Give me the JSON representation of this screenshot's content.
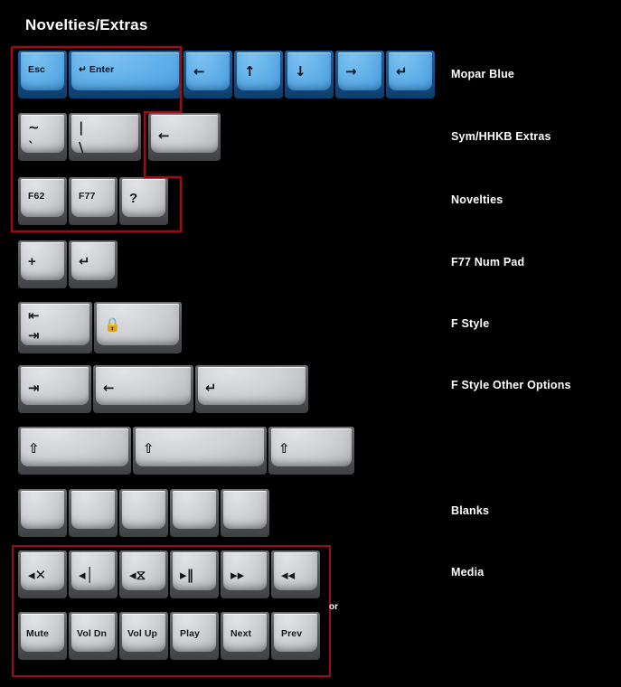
{
  "page": {
    "title": "Novelties/Extras",
    "background_color": "#000000",
    "text_color": "#ffffff",
    "highlight_color": "#9e0b16",
    "blue_cap_color": "#5aabe6",
    "grey_cap_color": "#c6c8cc",
    "or_label": "or"
  },
  "categories": [
    {
      "id": "mopar-blue",
      "label": "Mopar Blue"
    },
    {
      "id": "sym-hhkb-extras",
      "label": "Sym/HHKB Extras"
    },
    {
      "id": "novelties",
      "label": "Novelties"
    },
    {
      "id": "f77-num-pad",
      "label": "F77 Num Pad"
    },
    {
      "id": "f-style",
      "label": "F Style"
    },
    {
      "id": "f-style-other",
      "label": "F Style Other Options"
    },
    {
      "id": "blanks",
      "label": "Blanks"
    },
    {
      "id": "media",
      "label": "Media"
    }
  ],
  "rows": [
    {
      "id": "mopar-blue-row",
      "category": "Mopar Blue",
      "color": "blue",
      "keys": [
        {
          "name": "key-esc",
          "label": "Esc",
          "style": "text"
        },
        {
          "name": "key-enter-iso",
          "label": "↵ Enter",
          "style": "text"
        },
        {
          "name": "key-arrow-left",
          "label": "←",
          "style": "sym"
        },
        {
          "name": "key-arrow-up",
          "label": "↑",
          "style": "sym"
        },
        {
          "name": "key-arrow-down",
          "label": "↓",
          "style": "sym"
        },
        {
          "name": "key-arrow-right",
          "label": "→",
          "style": "sym"
        },
        {
          "name": "key-return",
          "label": "↵",
          "style": "sym"
        }
      ]
    },
    {
      "id": "sym-hhkb-row",
      "category": "Sym/HHKB Extras",
      "color": "grey",
      "keys": [
        {
          "name": "key-tilde-grave",
          "label": "~\n`",
          "style": "two-line"
        },
        {
          "name": "key-pipe-backslash",
          "label": "|\n\\",
          "style": "two-line"
        },
        {
          "name": "key-backspace",
          "label": "←",
          "style": "sym"
        }
      ]
    },
    {
      "id": "novelties-row",
      "category": "Novelties",
      "color": "grey",
      "keys": [
        {
          "name": "key-f62",
          "label": "F62",
          "style": "text"
        },
        {
          "name": "key-f77",
          "label": "F77",
          "style": "text"
        },
        {
          "name": "key-question",
          "label": "?",
          "style": "sym"
        }
      ]
    },
    {
      "id": "f77-num-pad-row",
      "category": "F77 Num Pad",
      "color": "grey",
      "keys": [
        {
          "name": "key-numpad-plus",
          "label": "+",
          "style": "sym"
        },
        {
          "name": "key-numpad-enter",
          "label": "↵",
          "style": "sym"
        }
      ]
    },
    {
      "id": "f-style-row",
      "category": "F Style",
      "color": "grey",
      "keys": [
        {
          "name": "key-tab-both",
          "label": "⇤\n⇥",
          "style": "two-line"
        },
        {
          "name": "key-caps-lock",
          "label": "🔒",
          "style": "sym"
        }
      ]
    },
    {
      "id": "f-style-other-row",
      "category": "F Style Other Options",
      "color": "grey",
      "keys": [
        {
          "name": "key-tab",
          "label": "⇥",
          "style": "sym"
        },
        {
          "name": "key-backspace-wide",
          "label": "←",
          "style": "sym"
        },
        {
          "name": "key-enter-wide",
          "label": "↵",
          "style": "sym"
        }
      ]
    },
    {
      "id": "shift-row",
      "category": "",
      "color": "grey",
      "keys": [
        {
          "name": "key-shift-left",
          "label": "⇧",
          "style": "sym"
        },
        {
          "name": "key-shift-right",
          "label": "⇧",
          "style": "sym"
        },
        {
          "name": "key-shift-short",
          "label": "⇧",
          "style": "sym"
        }
      ]
    },
    {
      "id": "blanks-row",
      "category": "Blanks",
      "color": "grey",
      "keys": [
        {
          "name": "key-blank-1",
          "label": "",
          "style": "text"
        },
        {
          "name": "key-blank-2",
          "label": "",
          "style": "text"
        },
        {
          "name": "key-blank-3",
          "label": "",
          "style": "text"
        },
        {
          "name": "key-blank-4",
          "label": "",
          "style": "text"
        },
        {
          "name": "key-blank-5",
          "label": "",
          "style": "text"
        }
      ]
    },
    {
      "id": "media-icon-row",
      "category": "Media",
      "color": "grey",
      "keys": [
        {
          "name": "key-mute-icon",
          "label": "◂✕",
          "style": "sym"
        },
        {
          "name": "key-vol-dn-icon",
          "label": "◂│",
          "style": "sym"
        },
        {
          "name": "key-vol-up-icon",
          "label": "◂⧖",
          "style": "sym"
        },
        {
          "name": "key-play-icon",
          "label": "▸‖",
          "style": "sym"
        },
        {
          "name": "key-next-icon",
          "label": "▸▸",
          "style": "sym"
        },
        {
          "name": "key-prev-icon",
          "label": "◂◂",
          "style": "sym"
        }
      ]
    },
    {
      "id": "media-text-row",
      "category": "",
      "color": "grey",
      "keys": [
        {
          "name": "key-mute-text",
          "label": "Mute",
          "style": "text"
        },
        {
          "name": "key-vol-dn-text",
          "label": "Vol Dn",
          "style": "text"
        },
        {
          "name": "key-vol-up-text",
          "label": "Vol Up",
          "style": "text"
        },
        {
          "name": "key-play-text",
          "label": "Play",
          "style": "text"
        },
        {
          "name": "key-next-text",
          "label": "Next",
          "style": "text"
        },
        {
          "name": "key-prev-text",
          "label": "Prev",
          "style": "text"
        }
      ]
    }
  ]
}
